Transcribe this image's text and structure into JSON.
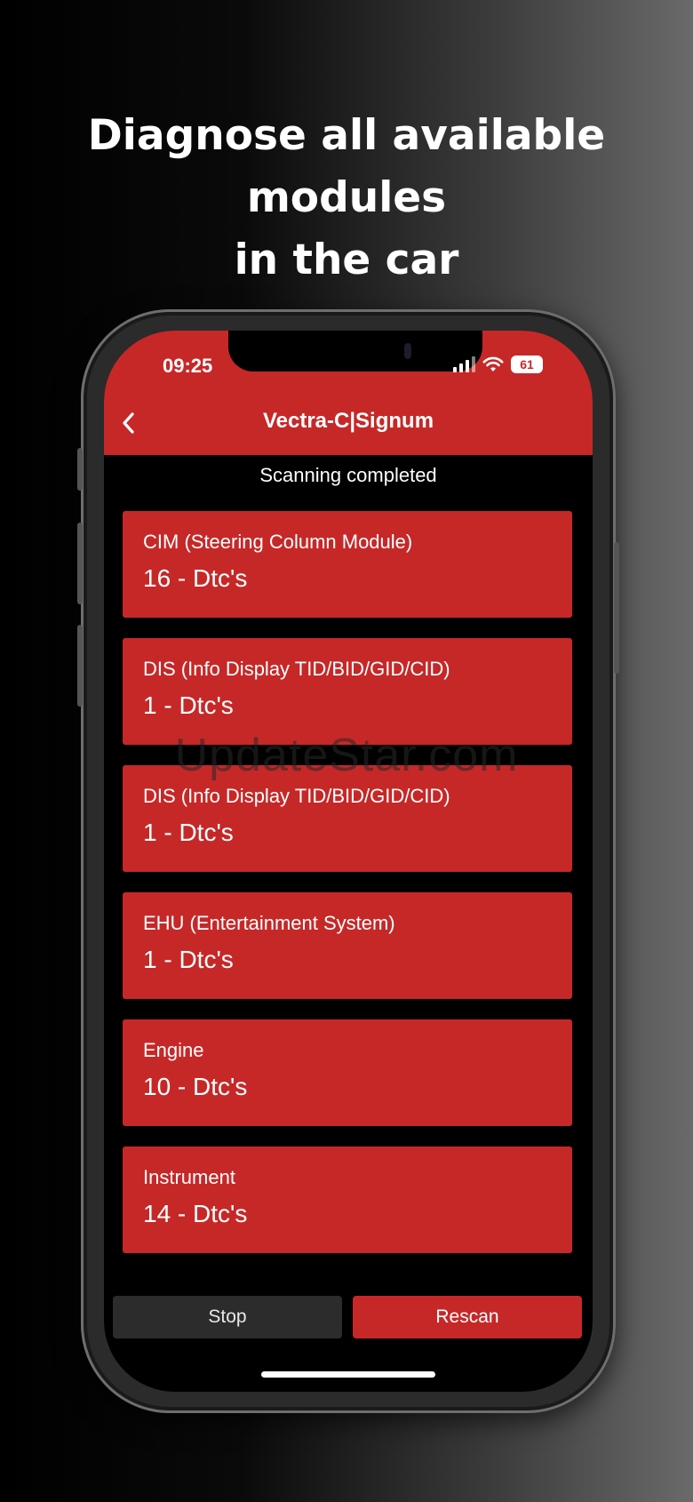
{
  "headline": {
    "line1": "Diagnose all available modules",
    "line2": "in the car"
  },
  "status_bar": {
    "time": "09:25",
    "battery": "61"
  },
  "app_bar": {
    "title": "Vectra-C|Signum",
    "back_icon": "chevron-left-icon"
  },
  "scan_status": "Scanning completed",
  "modules": [
    {
      "name": "CIM (Steering Column Module)",
      "dtc": "16 - Dtc's"
    },
    {
      "name": "DIS (Info Display TID/BID/GID/CID)",
      "dtc": "1 - Dtc's"
    },
    {
      "name": "DIS (Info Display TID/BID/GID/CID)",
      "dtc": "1 - Dtc's"
    },
    {
      "name": "EHU (Entertainment System)",
      "dtc": "1 - Dtc's"
    },
    {
      "name": "Engine",
      "dtc": "10 - Dtc's"
    },
    {
      "name": "Instrument",
      "dtc": "14 - Dtc's"
    }
  ],
  "buttons": {
    "stop": "Stop",
    "rescan": "Rescan"
  },
  "watermark": "UpdateStar.com",
  "colors": {
    "accent": "#c62828",
    "screen_background": "#000000",
    "stop_button": "#2c2c2c"
  }
}
